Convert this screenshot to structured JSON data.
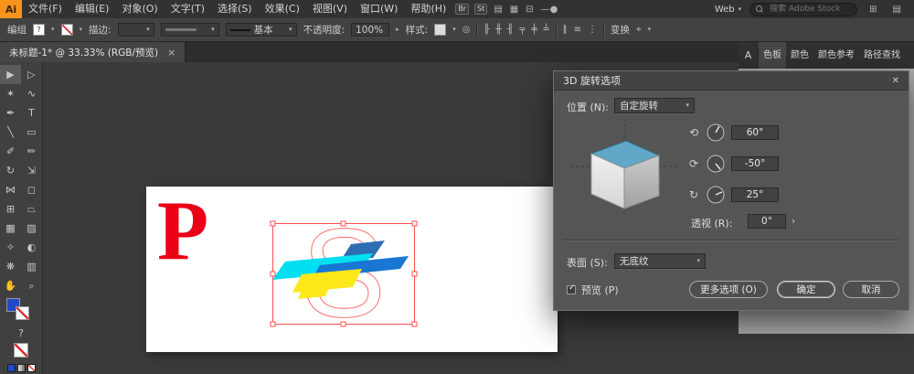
{
  "app": {
    "logo": "Ai"
  },
  "menubar": {
    "items": [
      "文件(F)",
      "编辑(E)",
      "对象(O)",
      "文字(T)",
      "选择(S)",
      "效果(C)",
      "视图(V)",
      "窗口(W)",
      "帮助(H)"
    ],
    "badges": [
      "Br",
      "St"
    ],
    "workspace": "Web",
    "search_placeholder": "搜索 Adobe Stock"
  },
  "controlbar": {
    "selection_type": "编组",
    "fill_unknown": "?",
    "stroke_label": "描边:",
    "brush_label": "基本",
    "opacity_label": "不透明度:",
    "opacity_value": "100%",
    "style_label": "样式:",
    "transform_label": "变换"
  },
  "document_tab": {
    "title": "未标题-1* @ 33.33% (RGB/预览)",
    "close": "×"
  },
  "panels": {
    "collapsed_icon": "A",
    "tabs": [
      "色板",
      "颜色",
      "颜色参考",
      "路径查找"
    ]
  },
  "dialog": {
    "title": "3D 旋转选项",
    "position_label": "位置 (N):",
    "position_value": "自定旋转",
    "rotation": {
      "x": "60°",
      "y": "-50°",
      "z": "25°"
    },
    "perspective_label": "透视 (R):",
    "perspective_value": "0°",
    "surface_label": "表面 (S):",
    "surface_value": "无底纹",
    "preview_label": "预览 (P)",
    "more_options": "更多选项 (O)",
    "ok": "确定",
    "cancel": "取消"
  },
  "artboard": {
    "letter": "P"
  },
  "icons": {
    "chevron_down": "▾",
    "chevron_right": "▸",
    "popup": "›",
    "close_x": "✕",
    "panel_menu": "≡",
    "check": "✓",
    "question": "?",
    "arrange": "⊞",
    "panels_toggle": "▤",
    "layout_a": "▤",
    "layout_b": "▦",
    "layout_c": "⊟",
    "slider": "—●",
    "recolor": "◎",
    "target": "⌖",
    "align": [
      "╟",
      "╫",
      "╢",
      "╤",
      "╪",
      "╧"
    ],
    "distribute": [
      "∥",
      "≡",
      "⋮"
    ],
    "rotate_x": "⟲",
    "rotate_y": "⟳",
    "rotate_z": "↻"
  },
  "tools": [
    {
      "name": "selection-tool",
      "glyph": "▶"
    },
    {
      "name": "direct-selection-tool",
      "glyph": "▷"
    },
    {
      "name": "magic-wand-tool",
      "glyph": "✶"
    },
    {
      "name": "lasso-tool",
      "glyph": "∿"
    },
    {
      "name": "pen-tool",
      "glyph": "✒"
    },
    {
      "name": "type-tool",
      "glyph": "T"
    },
    {
      "name": "line-segment-tool",
      "glyph": "╲"
    },
    {
      "name": "rectangle-tool",
      "glyph": "▭"
    },
    {
      "name": "paintbrush-tool",
      "glyph": "✐"
    },
    {
      "name": "pencil-tool",
      "glyph": "✏"
    },
    {
      "name": "rotate-tool",
      "glyph": "↻"
    },
    {
      "name": "scale-tool",
      "glyph": "⇲"
    },
    {
      "name": "width-tool",
      "glyph": "⋈"
    },
    {
      "name": "free-transform-tool",
      "glyph": "◻"
    },
    {
      "name": "shape-builder-tool",
      "glyph": "⊞"
    },
    {
      "name": "perspective-grid-tool",
      "glyph": "⏢"
    },
    {
      "name": "mesh-tool",
      "glyph": "▦"
    },
    {
      "name": "gradient-tool",
      "glyph": "▨"
    },
    {
      "name": "eyedropper-tool",
      "glyph": "✧"
    },
    {
      "name": "blend-tool",
      "glyph": "◐"
    },
    {
      "name": "symbol-sprayer-tool",
      "glyph": "❋"
    },
    {
      "name": "column-graph-tool",
      "glyph": "▥"
    },
    {
      "name": "hand-tool",
      "glyph": "✋"
    },
    {
      "name": "zoom-tool",
      "glyph": "⌕"
    }
  ],
  "colors": {
    "accent_red": "#ea0016",
    "selection_red": "#ff5050",
    "cyan": "#00dff2",
    "blue": "#1976d2",
    "navy": "#2f6db3",
    "yellow": "#ffe81a",
    "cube_top": "#5fa8c7",
    "fill_blue": "#1f49c7"
  }
}
